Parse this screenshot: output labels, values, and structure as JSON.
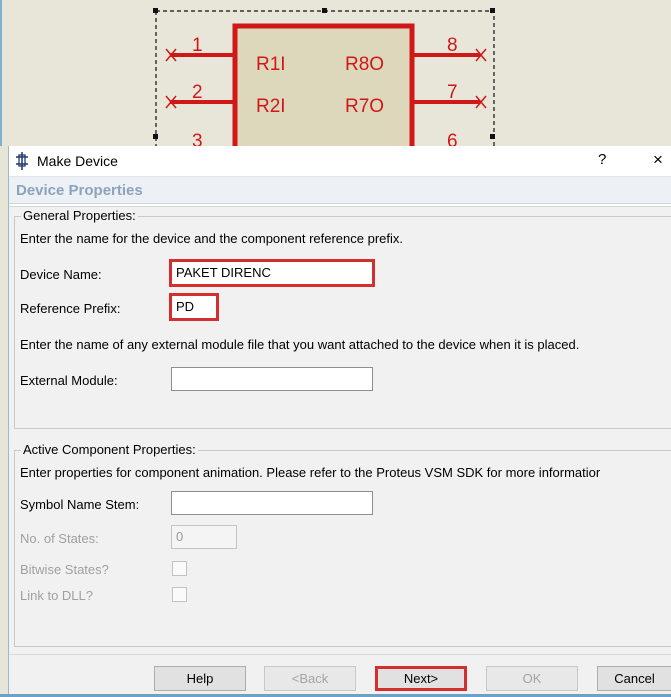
{
  "schematic": {
    "left_pins": [
      "1",
      "2",
      "3"
    ],
    "right_pins": [
      "8",
      "7",
      "6"
    ],
    "left_labels": [
      "R1I",
      "R2I"
    ],
    "right_labels": [
      "R8O",
      "R7O"
    ]
  },
  "window": {
    "title": "Make Device",
    "help_symbol": "?",
    "close_symbol": "×",
    "page_header": "Device Properties"
  },
  "general": {
    "legend": "General Properties:",
    "intro": "Enter the name for the device and the component reference prefix.",
    "device_name_label": "Device Name:",
    "device_name_value": "PAKET DIRENC",
    "ref_prefix_label": "Reference Prefix:",
    "ref_prefix_value": "PD",
    "module_intro": "Enter the name of any external module file that you want attached to the device when it is placed.",
    "external_module_label": "External Module:",
    "external_module_value": ""
  },
  "active": {
    "legend": "Active Component Properties:",
    "intro": "Enter properties for component animation. Please refer to the Proteus VSM SDK for more informatior",
    "symbol_stem_label": "Symbol Name Stem:",
    "symbol_stem_value": "",
    "states_label": "No. of States:",
    "states_value": "0",
    "bitwise_label": "Bitwise States?",
    "bitwise_checked": false,
    "dll_label": "Link to DLL?",
    "dll_checked": false
  },
  "buttons": {
    "help": "Help",
    "back": "<Back",
    "next": "Next>",
    "ok": "OK",
    "cancel": "Cancel"
  },
  "colors": {
    "highlight": "#d32f2f",
    "schematic_red": "#d01818",
    "header_text": "#8ca3bd"
  }
}
